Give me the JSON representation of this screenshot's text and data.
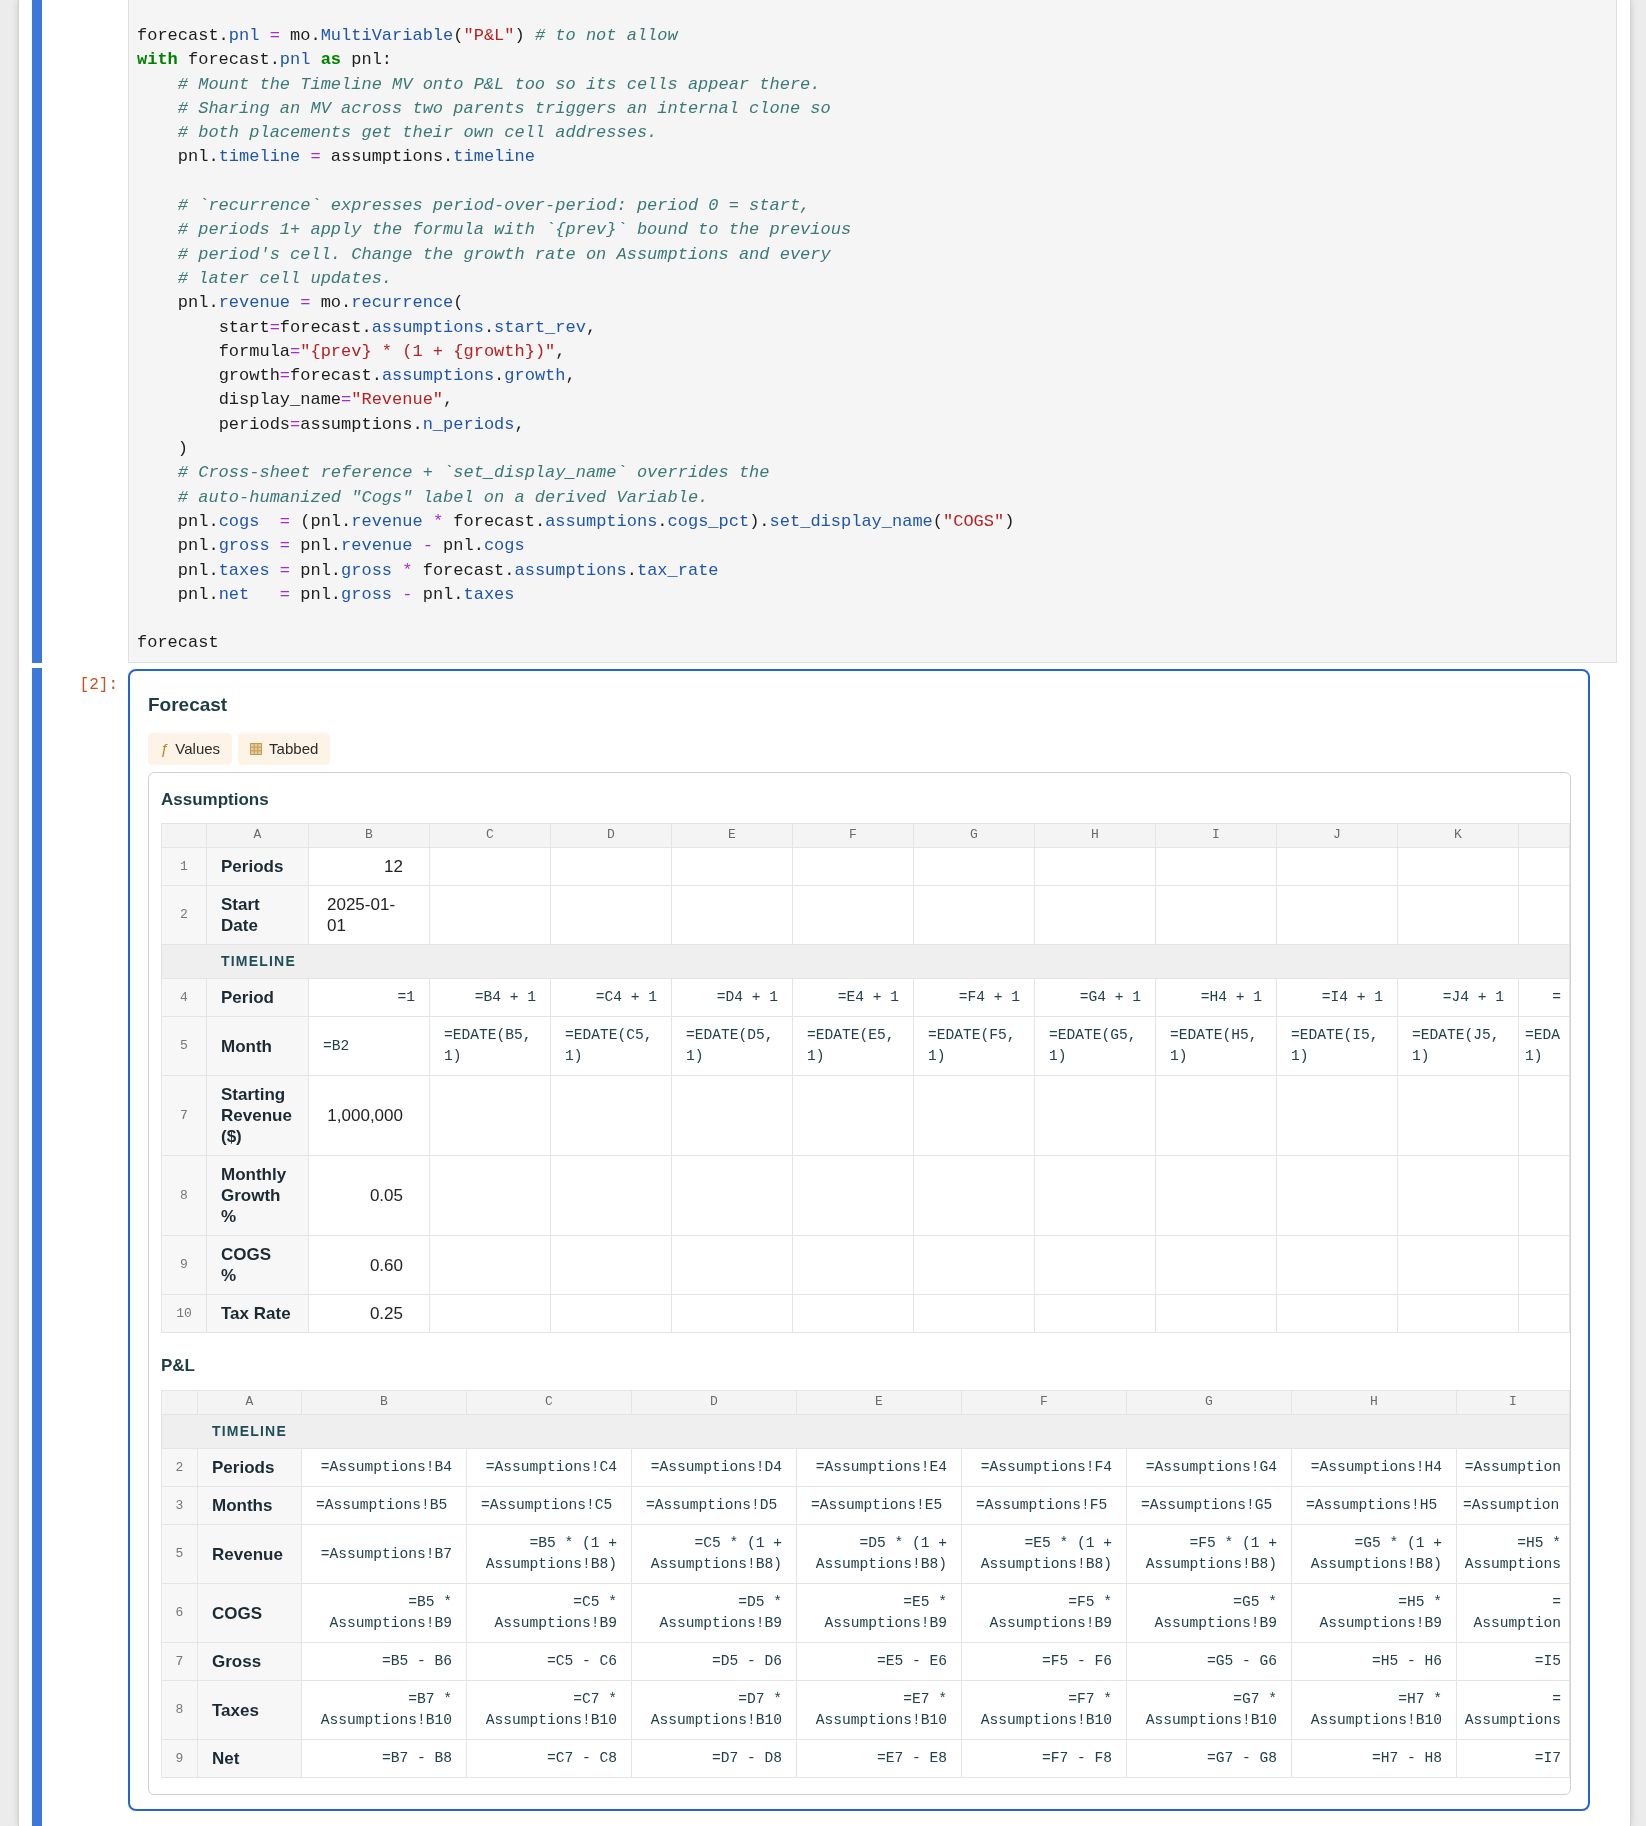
{
  "code_cell": {
    "lines": [
      {
        "kind": "code",
        "tokens": [
          {
            "kind": "plain",
            "text": "forecast."
          },
          {
            "kind": "property",
            "text": "pnl"
          },
          {
            "kind": "operator",
            "text": " = "
          },
          {
            "kind": "plain",
            "text": "mo."
          },
          {
            "kind": "property",
            "text": "MultiVariable"
          },
          {
            "kind": "plain",
            "text": "("
          },
          {
            "kind": "string",
            "text": "\"P&L\""
          },
          {
            "kind": "plain",
            "text": ") "
          },
          {
            "kind": "comment",
            "text": "# to not allow"
          }
        ]
      },
      {
        "kind": "code",
        "tokens": [
          {
            "kind": "keyword",
            "text": "with"
          },
          {
            "kind": "plain",
            "text": " forecast."
          },
          {
            "kind": "property",
            "text": "pnl"
          },
          {
            "kind": "keyword",
            "text": " as"
          },
          {
            "kind": "plain",
            "text": " pnl:"
          }
        ]
      },
      {
        "kind": "code",
        "tokens": [
          {
            "kind": "comment",
            "text": "    # Mount the Timeline MV onto P&L too so its cells appear there."
          }
        ]
      },
      {
        "kind": "code",
        "tokens": [
          {
            "kind": "comment",
            "text": "    # Sharing an MV across two parents triggers an internal clone so"
          }
        ]
      },
      {
        "kind": "code",
        "tokens": [
          {
            "kind": "comment",
            "text": "    # both placements get their own cell addresses."
          }
        ]
      },
      {
        "kind": "code",
        "tokens": [
          {
            "kind": "plain",
            "text": "    pnl."
          },
          {
            "kind": "property",
            "text": "timeline"
          },
          {
            "kind": "operator",
            "text": " = "
          },
          {
            "kind": "plain",
            "text": "assumptions."
          },
          {
            "kind": "property",
            "text": "timeline"
          }
        ]
      },
      {
        "kind": "blank"
      },
      {
        "kind": "code",
        "tokens": [
          {
            "kind": "comment",
            "text": "    # `recurrence` expresses period-over-period: period 0 = start,"
          }
        ]
      },
      {
        "kind": "code",
        "tokens": [
          {
            "kind": "comment",
            "text": "    # periods 1+ apply the formula with `{prev}` bound to the previous"
          }
        ]
      },
      {
        "kind": "code",
        "tokens": [
          {
            "kind": "comment",
            "text": "    # period's cell. Change the growth rate on Assumptions and every"
          }
        ]
      },
      {
        "kind": "code",
        "tokens": [
          {
            "kind": "comment",
            "text": "    # later cell updates."
          }
        ]
      },
      {
        "kind": "code",
        "tokens": [
          {
            "kind": "plain",
            "text": "    pnl."
          },
          {
            "kind": "property",
            "text": "revenue"
          },
          {
            "kind": "operator",
            "text": " = "
          },
          {
            "kind": "plain",
            "text": "mo."
          },
          {
            "kind": "property",
            "text": "recurrence"
          },
          {
            "kind": "plain",
            "text": "("
          }
        ]
      },
      {
        "kind": "code",
        "tokens": [
          {
            "kind": "plain",
            "text": "        start"
          },
          {
            "kind": "operator",
            "text": "="
          },
          {
            "kind": "plain",
            "text": "forecast."
          },
          {
            "kind": "property",
            "text": "assumptions"
          },
          {
            "kind": "plain",
            "text": "."
          },
          {
            "kind": "property",
            "text": "start_rev"
          },
          {
            "kind": "plain",
            "text": ","
          }
        ]
      },
      {
        "kind": "code",
        "tokens": [
          {
            "kind": "plain",
            "text": "        formula"
          },
          {
            "kind": "operator",
            "text": "="
          },
          {
            "kind": "string",
            "text": "\"{prev} * (1 + {growth})\""
          },
          {
            "kind": "plain",
            "text": ","
          }
        ]
      },
      {
        "kind": "code",
        "tokens": [
          {
            "kind": "plain",
            "text": "        growth"
          },
          {
            "kind": "operator",
            "text": "="
          },
          {
            "kind": "plain",
            "text": "forecast."
          },
          {
            "kind": "property",
            "text": "assumptions"
          },
          {
            "kind": "plain",
            "text": "."
          },
          {
            "kind": "property",
            "text": "growth"
          },
          {
            "kind": "plain",
            "text": ","
          }
        ]
      },
      {
        "kind": "code",
        "tokens": [
          {
            "kind": "plain",
            "text": "        display_name"
          },
          {
            "kind": "operator",
            "text": "="
          },
          {
            "kind": "string",
            "text": "\"Revenue\""
          },
          {
            "kind": "plain",
            "text": ","
          }
        ]
      },
      {
        "kind": "code",
        "tokens": [
          {
            "kind": "plain",
            "text": "        periods"
          },
          {
            "kind": "operator",
            "text": "="
          },
          {
            "kind": "plain",
            "text": "assumptions."
          },
          {
            "kind": "property",
            "text": "n_periods"
          },
          {
            "kind": "plain",
            "text": ","
          }
        ]
      },
      {
        "kind": "code",
        "tokens": [
          {
            "kind": "plain",
            "text": "    )"
          }
        ]
      },
      {
        "kind": "code",
        "tokens": [
          {
            "kind": "comment",
            "text": "    # Cross-sheet reference + `set_display_name` overrides the"
          }
        ]
      },
      {
        "kind": "code",
        "tokens": [
          {
            "kind": "comment",
            "text": "    # auto-humanized \"Cogs\" label on a derived Variable."
          }
        ]
      },
      {
        "kind": "code",
        "tokens": [
          {
            "kind": "plain",
            "text": "    pnl."
          },
          {
            "kind": "property",
            "text": "cogs"
          },
          {
            "kind": "operator",
            "text": "  = "
          },
          {
            "kind": "plain",
            "text": "(pnl."
          },
          {
            "kind": "property",
            "text": "revenue"
          },
          {
            "kind": "operator",
            "text": " * "
          },
          {
            "kind": "plain",
            "text": "forecast."
          },
          {
            "kind": "property",
            "text": "assumptions"
          },
          {
            "kind": "plain",
            "text": "."
          },
          {
            "kind": "property",
            "text": "cogs_pct"
          },
          {
            "kind": "plain",
            "text": ")."
          },
          {
            "kind": "property",
            "text": "set_display_name"
          },
          {
            "kind": "plain",
            "text": "("
          },
          {
            "kind": "string",
            "text": "\"COGS\""
          },
          {
            "kind": "plain",
            "text": ")"
          }
        ]
      },
      {
        "kind": "code",
        "tokens": [
          {
            "kind": "plain",
            "text": "    pnl."
          },
          {
            "kind": "property",
            "text": "gross"
          },
          {
            "kind": "operator",
            "text": " = "
          },
          {
            "kind": "plain",
            "text": "pnl."
          },
          {
            "kind": "property",
            "text": "revenue"
          },
          {
            "kind": "operator",
            "text": " - "
          },
          {
            "kind": "plain",
            "text": "pnl."
          },
          {
            "kind": "property",
            "text": "cogs"
          }
        ]
      },
      {
        "kind": "code",
        "tokens": [
          {
            "kind": "plain",
            "text": "    pnl."
          },
          {
            "kind": "property",
            "text": "taxes"
          },
          {
            "kind": "operator",
            "text": " = "
          },
          {
            "kind": "plain",
            "text": "pnl."
          },
          {
            "kind": "property",
            "text": "gross"
          },
          {
            "kind": "operator",
            "text": " * "
          },
          {
            "kind": "plain",
            "text": "forecast."
          },
          {
            "kind": "property",
            "text": "assumptions"
          },
          {
            "kind": "plain",
            "text": "."
          },
          {
            "kind": "property",
            "text": "tax_rate"
          }
        ]
      },
      {
        "kind": "code",
        "tokens": [
          {
            "kind": "plain",
            "text": "    pnl."
          },
          {
            "kind": "property",
            "text": "net"
          },
          {
            "kind": "operator",
            "text": "   = "
          },
          {
            "kind": "plain",
            "text": "pnl."
          },
          {
            "kind": "property",
            "text": "gross"
          },
          {
            "kind": "operator",
            "text": " - "
          },
          {
            "kind": "plain",
            "text": "pnl."
          },
          {
            "kind": "property",
            "text": "taxes"
          }
        ]
      },
      {
        "kind": "blank"
      },
      {
        "kind": "code",
        "tokens": [
          {
            "kind": "plain",
            "text": "forecast"
          }
        ]
      }
    ]
  },
  "output_cell": {
    "prompt": "[2]:",
    "title": "Forecast",
    "buttons": [
      {
        "kind": "glyph",
        "glyph": "ƒ",
        "label": "Values"
      },
      {
        "kind": "icon",
        "label": "Tabbed"
      }
    ],
    "sheets": [
      {
        "title": "Assumptions",
        "columns": [
          "A",
          "B",
          "C",
          "D",
          "E",
          "F",
          "G",
          "H",
          "I",
          "J",
          "K"
        ],
        "rows": [
          {
            "kind": "data",
            "number": "1",
            "label": "Periods",
            "numeric": true,
            "cells": [
              {
                "kind": "value",
                "text": "12"
              }
            ]
          },
          {
            "kind": "data",
            "number": "2",
            "label": "Start Date",
            "numeric": false,
            "cells": [
              {
                "kind": "value",
                "text": "2025-01-01"
              }
            ]
          },
          {
            "kind": "section",
            "label": "TIMELINE"
          },
          {
            "kind": "data",
            "number": "4",
            "label": "Period",
            "numeric": true,
            "cells": [
              {
                "kind": "formula",
                "text": "=1"
              },
              {
                "kind": "formula",
                "text": "=B4 + 1"
              },
              {
                "kind": "formula",
                "text": "=C4 + 1"
              },
              {
                "kind": "formula",
                "text": "=D4 + 1"
              },
              {
                "kind": "formula",
                "text": "=E4 + 1"
              },
              {
                "kind": "formula",
                "text": "=F4 + 1"
              },
              {
                "kind": "formula",
                "text": "=G4 + 1"
              },
              {
                "kind": "formula",
                "text": "=H4 + 1"
              },
              {
                "kind": "formula",
                "text": "=I4 + 1"
              },
              {
                "kind": "formula",
                "text": "=J4 + 1"
              },
              {
                "kind": "formula",
                "text": "="
              }
            ]
          },
          {
            "kind": "data",
            "number": "5",
            "label": "Month",
            "numeric": false,
            "cells": [
              {
                "kind": "formula",
                "text": "=B2"
              },
              {
                "kind": "formula",
                "text": "=EDATE(B5, 1)"
              },
              {
                "kind": "formula",
                "text": "=EDATE(C5, 1)"
              },
              {
                "kind": "formula",
                "text": "=EDATE(D5, 1)"
              },
              {
                "kind": "formula",
                "text": "=EDATE(E5, 1)"
              },
              {
                "kind": "formula",
                "text": "=EDATE(F5, 1)"
              },
              {
                "kind": "formula",
                "text": "=EDATE(G5, 1)"
              },
              {
                "kind": "formula",
                "text": "=EDATE(H5, 1)"
              },
              {
                "kind": "formula",
                "text": "=EDATE(I5, 1)"
              },
              {
                "kind": "formula",
                "text": "=EDATE(J5, 1)"
              },
              {
                "kind": "formula",
                "text": "=EDA 1)"
              }
            ]
          },
          {
            "kind": "data",
            "number": "7",
            "label": "Starting Revenue ($)",
            "numeric": true,
            "cells": [
              {
                "kind": "value",
                "text": "1,000,000"
              }
            ]
          },
          {
            "kind": "data",
            "number": "8",
            "label": "Monthly Growth %",
            "numeric": true,
            "cells": [
              {
                "kind": "value",
                "text": "0.05"
              }
            ]
          },
          {
            "kind": "data",
            "number": "9",
            "label": "COGS\n%",
            "numeric": true,
            "cells": [
              {
                "kind": "value",
                "text": "0.60"
              }
            ]
          },
          {
            "kind": "data",
            "number": "10",
            "label": "Tax Rate",
            "numeric": true,
            "cells": [
              {
                "kind": "value",
                "text": "0.25"
              }
            ]
          }
        ]
      },
      {
        "title": "P&L",
        "columns": [
          "A",
          "B",
          "C",
          "D",
          "E",
          "F",
          "G",
          "H",
          "I"
        ],
        "rows": [
          {
            "kind": "section",
            "label": "TIMELINE"
          },
          {
            "kind": "data",
            "number": "2",
            "label": "Periods",
            "numeric": true,
            "cells": [
              {
                "kind": "formula",
                "text": "=Assumptions!B4"
              },
              {
                "kind": "formula",
                "text": "=Assumptions!C4"
              },
              {
                "kind": "formula",
                "text": "=Assumptions!D4"
              },
              {
                "kind": "formula",
                "text": "=Assumptions!E4"
              },
              {
                "kind": "formula",
                "text": "=Assumptions!F4"
              },
              {
                "kind": "formula",
                "text": "=Assumptions!G4"
              },
              {
                "kind": "formula",
                "text": "=Assumptions!H4"
              },
              {
                "kind": "formula",
                "text": "=Assumption"
              }
            ]
          },
          {
            "kind": "data",
            "number": "3",
            "label": "Months",
            "numeric": false,
            "cells": [
              {
                "kind": "formula",
                "text": "=Assumptions!B5"
              },
              {
                "kind": "formula",
                "text": "=Assumptions!C5"
              },
              {
                "kind": "formula",
                "text": "=Assumptions!D5"
              },
              {
                "kind": "formula",
                "text": "=Assumptions!E5"
              },
              {
                "kind": "formula",
                "text": "=Assumptions!F5"
              },
              {
                "kind": "formula",
                "text": "=Assumptions!G5"
              },
              {
                "kind": "formula",
                "text": "=Assumptions!H5"
              },
              {
                "kind": "formula",
                "text": "=Assumption"
              }
            ]
          },
          {
            "kind": "data",
            "number": "5",
            "label": "Revenue",
            "numeric": true,
            "cells": [
              {
                "kind": "formula",
                "text": "=Assumptions!B7"
              },
              {
                "kind": "formula",
                "text": "=B5 * (1 + Assumptions!B8)"
              },
              {
                "kind": "formula",
                "text": "=C5 * (1 + Assumptions!B8)"
              },
              {
                "kind": "formula",
                "text": "=D5 * (1 + Assumptions!B8)"
              },
              {
                "kind": "formula",
                "text": "=E5 * (1 + Assumptions!B8)"
              },
              {
                "kind": "formula",
                "text": "=F5 * (1 + Assumptions!B8)"
              },
              {
                "kind": "formula",
                "text": "=G5 * (1 + Assumptions!B8)"
              },
              {
                "kind": "formula",
                "text": "=H5 * Assumptions"
              }
            ]
          },
          {
            "kind": "data",
            "number": "6",
            "label": "COGS",
            "numeric": true,
            "cells": [
              {
                "kind": "formula",
                "text": "=B5 * Assumptions!B9"
              },
              {
                "kind": "formula",
                "text": "=C5 * Assumptions!B9"
              },
              {
                "kind": "formula",
                "text": "=D5 * Assumptions!B9"
              },
              {
                "kind": "formula",
                "text": "=E5 * Assumptions!B9"
              },
              {
                "kind": "formula",
                "text": "=F5 * Assumptions!B9"
              },
              {
                "kind": "formula",
                "text": "=G5 * Assumptions!B9"
              },
              {
                "kind": "formula",
                "text": "=H5 * Assumptions!B9"
              },
              {
                "kind": "formula",
                "text": "= Assumption"
              }
            ]
          },
          {
            "kind": "data",
            "number": "7",
            "label": "Gross",
            "numeric": true,
            "cells": [
              {
                "kind": "formula",
                "text": "=B5 - B6"
              },
              {
                "kind": "formula",
                "text": "=C5 - C6"
              },
              {
                "kind": "formula",
                "text": "=D5 - D6"
              },
              {
                "kind": "formula",
                "text": "=E5 - E6"
              },
              {
                "kind": "formula",
                "text": "=F5 - F6"
              },
              {
                "kind": "formula",
                "text": "=G5 - G6"
              },
              {
                "kind": "formula",
                "text": "=H5 - H6"
              },
              {
                "kind": "formula",
                "text": "=I5"
              }
            ]
          },
          {
            "kind": "data",
            "number": "8",
            "label": "Taxes",
            "numeric": true,
            "cells": [
              {
                "kind": "formula",
                "text": "=B7 * Assumptions!B10"
              },
              {
                "kind": "formula",
                "text": "=C7 * Assumptions!B10"
              },
              {
                "kind": "formula",
                "text": "=D7 * Assumptions!B10"
              },
              {
                "kind": "formula",
                "text": "=E7 * Assumptions!B10"
              },
              {
                "kind": "formula",
                "text": "=F7 * Assumptions!B10"
              },
              {
                "kind": "formula",
                "text": "=G7 * Assumptions!B10"
              },
              {
                "kind": "formula",
                "text": "=H7 * Assumptions!B10"
              },
              {
                "kind": "formula",
                "text": "= Assumptions"
              }
            ]
          },
          {
            "kind": "data",
            "number": "9",
            "label": "Net",
            "numeric": true,
            "cells": [
              {
                "kind": "formula",
                "text": "=B7 - B8"
              },
              {
                "kind": "formula",
                "text": "=C7 - C8"
              },
              {
                "kind": "formula",
                "text": "=D7 - D8"
              },
              {
                "kind": "formula",
                "text": "=E7 - E8"
              },
              {
                "kind": "formula",
                "text": "=F7 - F8"
              },
              {
                "kind": "formula",
                "text": "=G7 - G8"
              },
              {
                "kind": "formula",
                "text": "=H7 - H8"
              },
              {
                "kind": "formula",
                "text": "=I7"
              }
            ]
          }
        ]
      }
    ]
  }
}
